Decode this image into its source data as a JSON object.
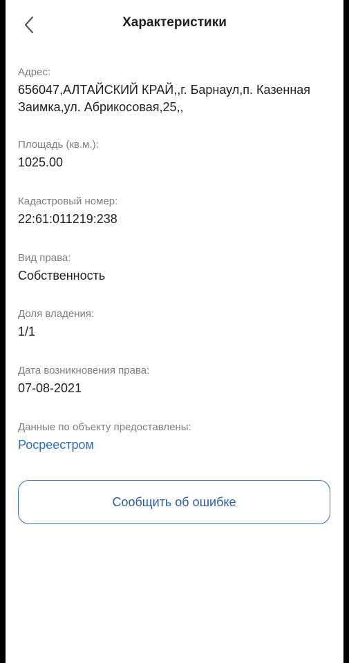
{
  "header": {
    "title": "Характеристики"
  },
  "fields": {
    "address": {
      "label": "Адрес:",
      "value": "656047,АЛТАЙСКИЙ КРАЙ,,г. Барнаул,п. Казенная Заимка,ул. Абрикосовая,25,,"
    },
    "area": {
      "label": "Площадь (кв.м.):",
      "value": "1025.00"
    },
    "cadastral": {
      "label": "Кадастровый номер:",
      "value": "22:61:011219:238"
    },
    "right_type": {
      "label": "Вид права:",
      "value": "Собственность"
    },
    "share": {
      "label": "Доля владения:",
      "value": "1/1"
    },
    "right_date": {
      "label": "Дата возникновения права:",
      "value": "07-08-2021"
    },
    "provider": {
      "label": "Данные по объекту предоставлены:",
      "value": "Росреестром"
    }
  },
  "actions": {
    "report_label": "Сообщить об ошибке"
  },
  "colors": {
    "accent": "#2d6db5",
    "label": "#7d7d7d",
    "text": "#1f1f1f"
  }
}
